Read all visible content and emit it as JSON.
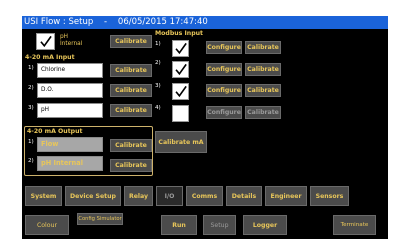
{
  "window": {
    "title": "USI Flow : Setup    -    06/05/2015 17:47:40"
  },
  "top_checkbox": {
    "label_line1": "pH",
    "label_line2": "Internal",
    "calibrate": "Calibrate"
  },
  "input_section": {
    "header": "4-20 mA Input",
    "rows": [
      {
        "num": "1)",
        "value": "Chlorine",
        "calibrate": "Calibrate"
      },
      {
        "num": "2)",
        "value": "D.O.",
        "calibrate": "Calibrate"
      },
      {
        "num": "3)",
        "value": "pH",
        "calibrate": "Calibrate"
      }
    ]
  },
  "output_section": {
    "header": "4-20 mA Output",
    "rows": [
      {
        "num": "1)",
        "value": "Flow",
        "calibrate": "Calibrate"
      },
      {
        "num": "2)",
        "value": "pH Internal",
        "calibrate": "Calibrate"
      }
    ],
    "calibrate_ma": "Calibrate mA"
  },
  "modbus": {
    "header": "Modbus Input",
    "rows": [
      {
        "num": "1)",
        "checked": true,
        "configure": "Configure",
        "calibrate": "Calibrate"
      },
      {
        "num": "2)",
        "checked": true,
        "configure": "Configure",
        "calibrate": "Calibrate"
      },
      {
        "num": "3)",
        "checked": true,
        "configure": "Configure",
        "calibrate": "Calibrate"
      },
      {
        "num": "4)",
        "checked": false,
        "configure": "Configure",
        "calibrate": "Calibrate"
      }
    ]
  },
  "nav_row1": [
    "System",
    "Device Setup",
    "Relay",
    "I/O",
    "Comms",
    "Details",
    "Engineer",
    "Sensors"
  ],
  "nav_row2": {
    "colour": "Colour",
    "config_sim": "Config Simulator",
    "run": "Run",
    "setup": "Setup",
    "logger": "Logger",
    "terminate": "Terminate"
  },
  "colors": {
    "accent": "#e8c65a",
    "title_bar": "#1a63d9",
    "button": "#4b4b4b"
  }
}
